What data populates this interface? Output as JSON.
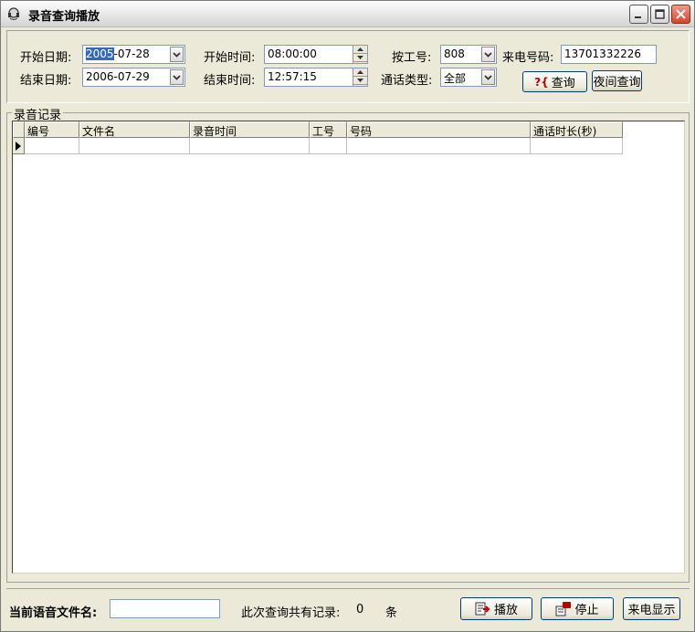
{
  "window": {
    "title": "录音查询播放",
    "icon": "headset-icon",
    "controls": [
      "minimize-icon",
      "maximize-icon",
      "close-icon"
    ]
  },
  "query": {
    "start_date_label": "开始日期:",
    "start_date_value_sel": "2005",
    "start_date_value_rest": "-07-28",
    "end_date_label": "结束日期:",
    "end_date_value": "2006-07-29",
    "start_time_label": "开始时间:",
    "start_time_value": "08:00:00",
    "end_time_label": "结束时间:",
    "end_time_value": "12:57:15",
    "agent_id_label": "按工号:",
    "agent_id_value": "808",
    "call_type_label": "通话类型:",
    "call_type_value": "全部",
    "caller_number_label": "来电号码:",
    "caller_number_value": "13701332226",
    "query_button": "查询",
    "query_button_icon": "?{",
    "night_query_button": "夜间查询"
  },
  "records": {
    "group_label": "录音记录",
    "columns": [
      "编号",
      "文件名",
      "录音时间",
      "工号",
      "号码",
      "通话时长(秒)"
    ]
  },
  "footer": {
    "current_file_label": "当前语音文件名:",
    "current_file_value": "",
    "record_count_label": "此次查询共有记录:",
    "record_count_value": "0",
    "record_count_unit": "条",
    "play_button": "播放",
    "stop_button": "停止",
    "caller_display_button": "来电显示"
  }
}
